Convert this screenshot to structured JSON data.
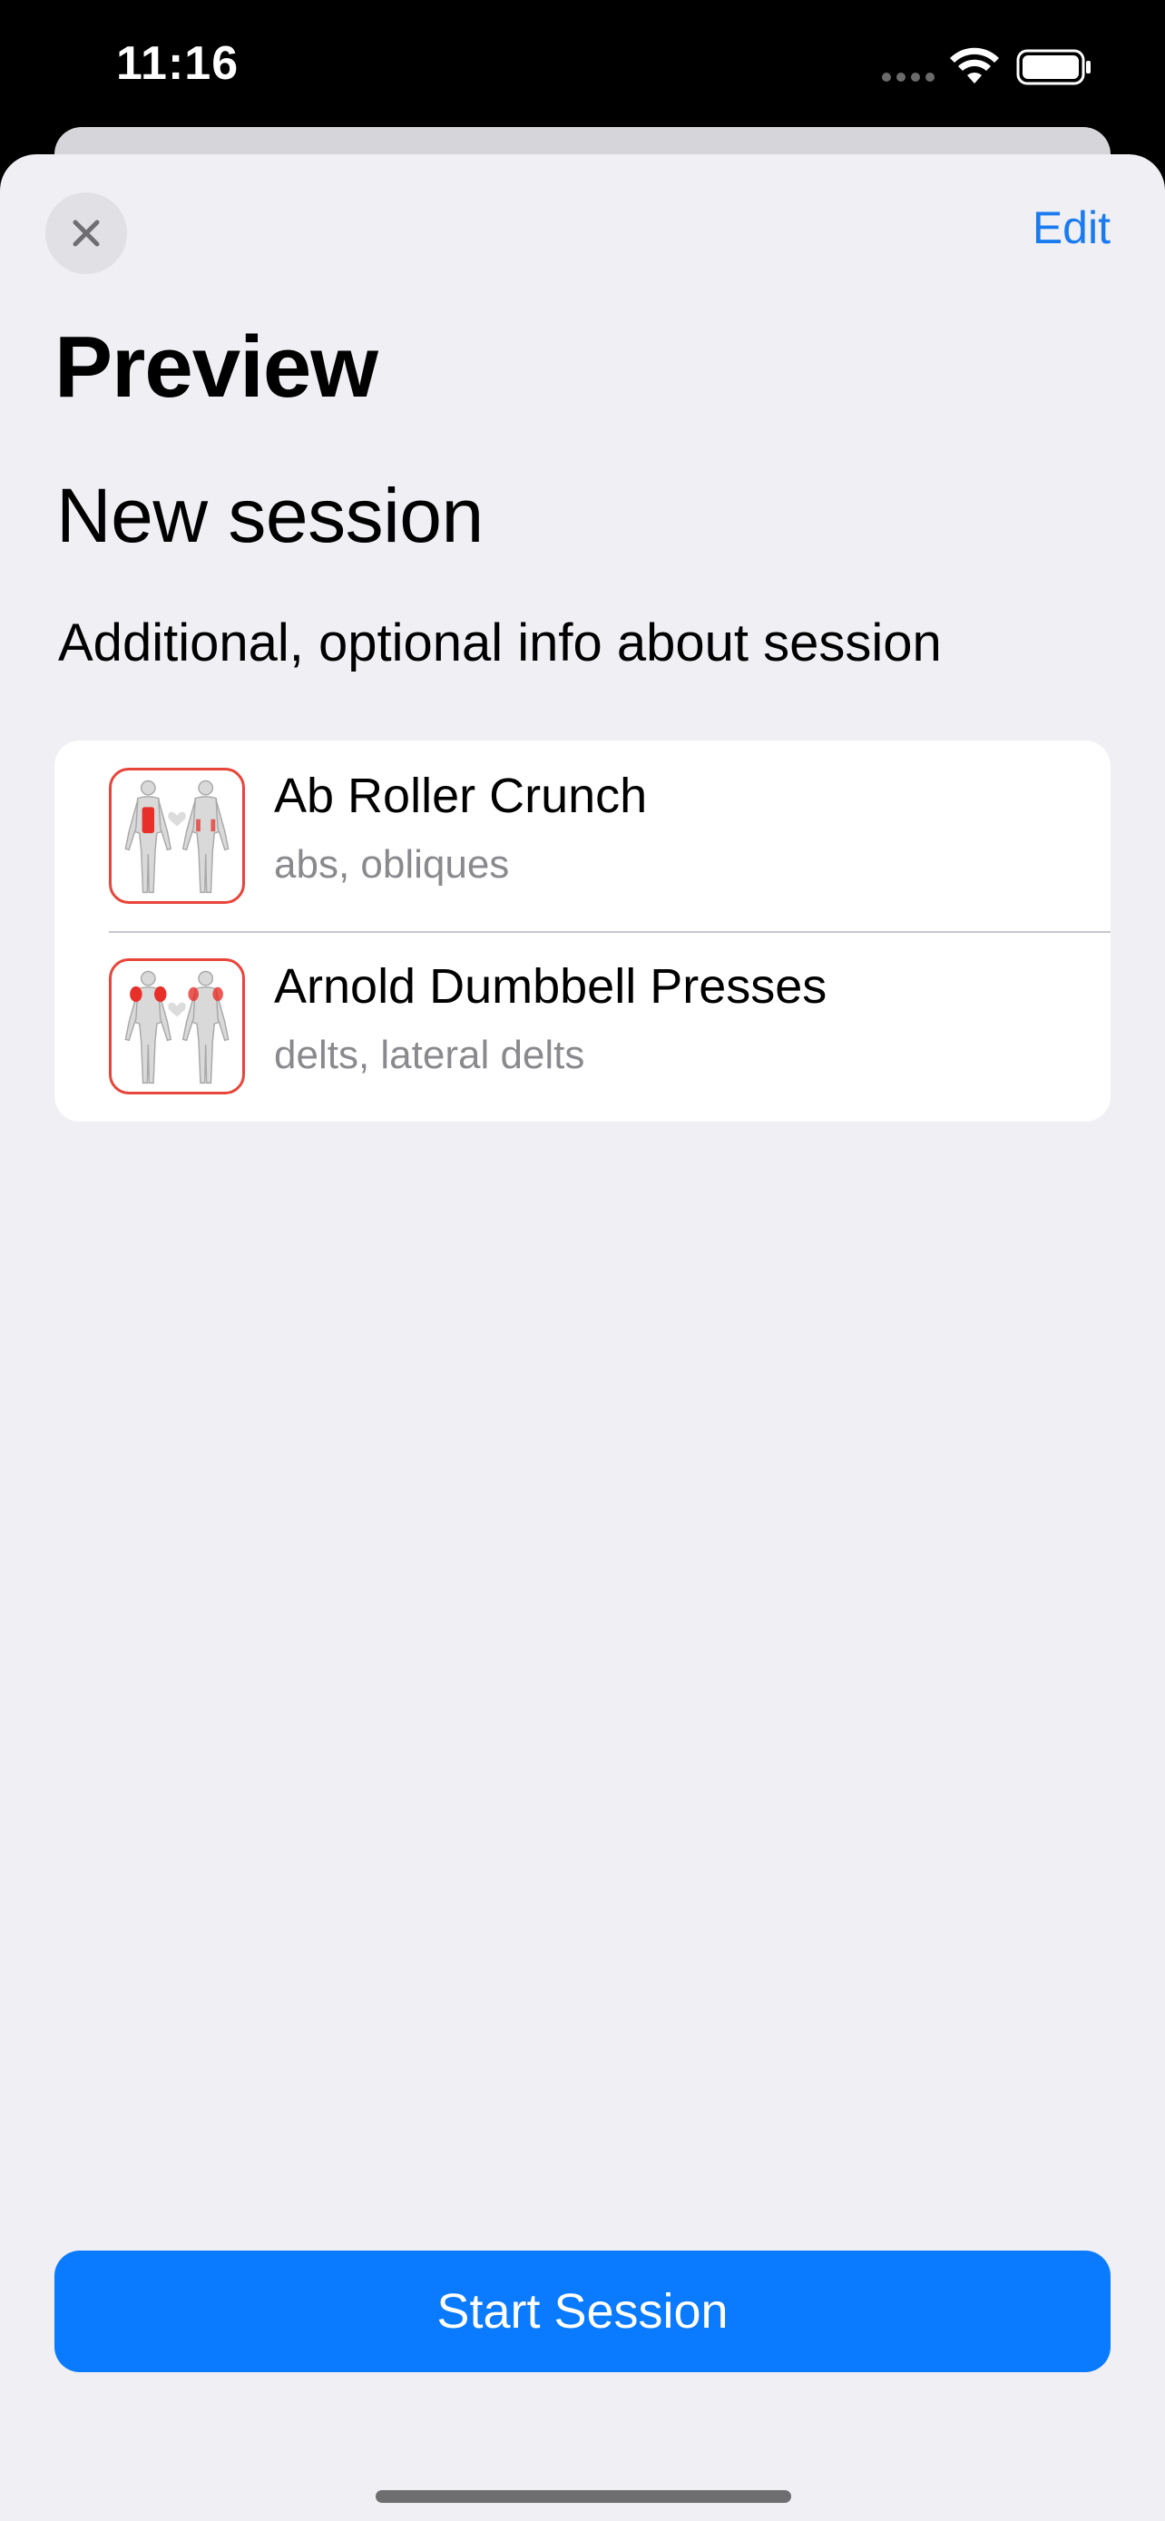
{
  "status_bar": {
    "time": "11:16",
    "icons": [
      "signal-dots-icon",
      "wifi-icon",
      "battery-icon"
    ]
  },
  "header": {
    "close_icon": "close-icon",
    "edit_label": "Edit"
  },
  "page_title": "Preview",
  "session": {
    "name": "New session",
    "info": "Additional, optional info about session"
  },
  "exercises": [
    {
      "name": "Ab Roller Crunch",
      "muscles": "abs, obliques",
      "highlight": "abs"
    },
    {
      "name": "Arnold Dumbbell Presses",
      "muscles": "delts, lateral delts",
      "highlight": "delts"
    }
  ],
  "start_button_label": "Start Session",
  "colors": {
    "accent": "#0a7aff",
    "link": "#1a7bf0",
    "thumb_border": "#e8453a",
    "muscle_highlight": "#e8302a",
    "background": "#efeff4"
  }
}
